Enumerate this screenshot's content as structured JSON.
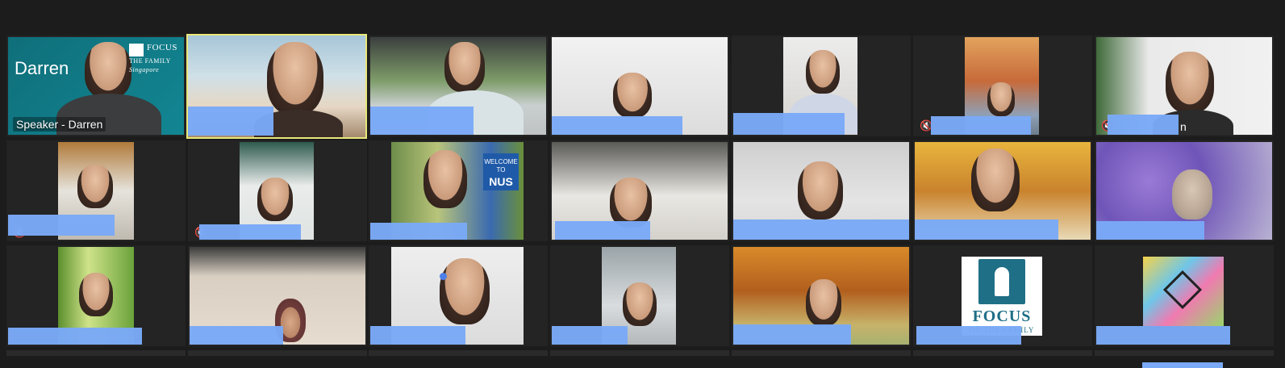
{
  "window": {
    "background": "#1c1c1c",
    "highlight_border": "#e8e77b",
    "redaction_color": "#7aa9f7"
  },
  "tiles": [
    {
      "id": "r1c1",
      "label": "Speaker - Darren",
      "overlay_title": "Darren",
      "logo_text": "FOCUS",
      "logo_sub": "THE FAMILY",
      "logo_sub2": "Singapore",
      "muted": false
    },
    {
      "id": "r1c2",
      "label": "",
      "active_speaker": true,
      "muted": false
    },
    {
      "id": "r1c3",
      "label": "",
      "muted": false
    },
    {
      "id": "r1c4",
      "label": "",
      "muted": false
    },
    {
      "id": "r1c5",
      "label": "",
      "muted": false
    },
    {
      "id": "r1c6",
      "label": "",
      "muted": true
    },
    {
      "id": "r1c7",
      "label": "n",
      "muted": true
    },
    {
      "id": "r2c1",
      "label": "",
      "muted": true
    },
    {
      "id": "r2c2",
      "label": "",
      "muted": true
    },
    {
      "id": "r2c3",
      "label": "",
      "sign_line1": "WELCOME",
      "sign_line2": "TO",
      "sign_line3": "NUS",
      "muted": false
    },
    {
      "id": "r2c4",
      "label": "",
      "muted": false
    },
    {
      "id": "r2c5",
      "label": "",
      "muted": false
    },
    {
      "id": "r2c6",
      "label": "",
      "muted": false
    },
    {
      "id": "r2c7",
      "label": "",
      "muted": false
    },
    {
      "id": "r3c1",
      "label": "",
      "muted": false
    },
    {
      "id": "r3c2",
      "label": "",
      "muted": false
    },
    {
      "id": "r3c3",
      "label": "",
      "muted": false
    },
    {
      "id": "r3c4",
      "label": "",
      "muted": false
    },
    {
      "id": "r3c5",
      "label": "",
      "muted": false
    },
    {
      "id": "r3c6",
      "label": "",
      "logo_text": "FOCUS",
      "logo_sub": "ON THE FAMILY",
      "muted": false
    },
    {
      "id": "r3c7",
      "label": "",
      "muted": false
    }
  ],
  "icons": {
    "mute": "microphone-muted-icon",
    "logo": "focus-on-the-family-logo-icon"
  }
}
